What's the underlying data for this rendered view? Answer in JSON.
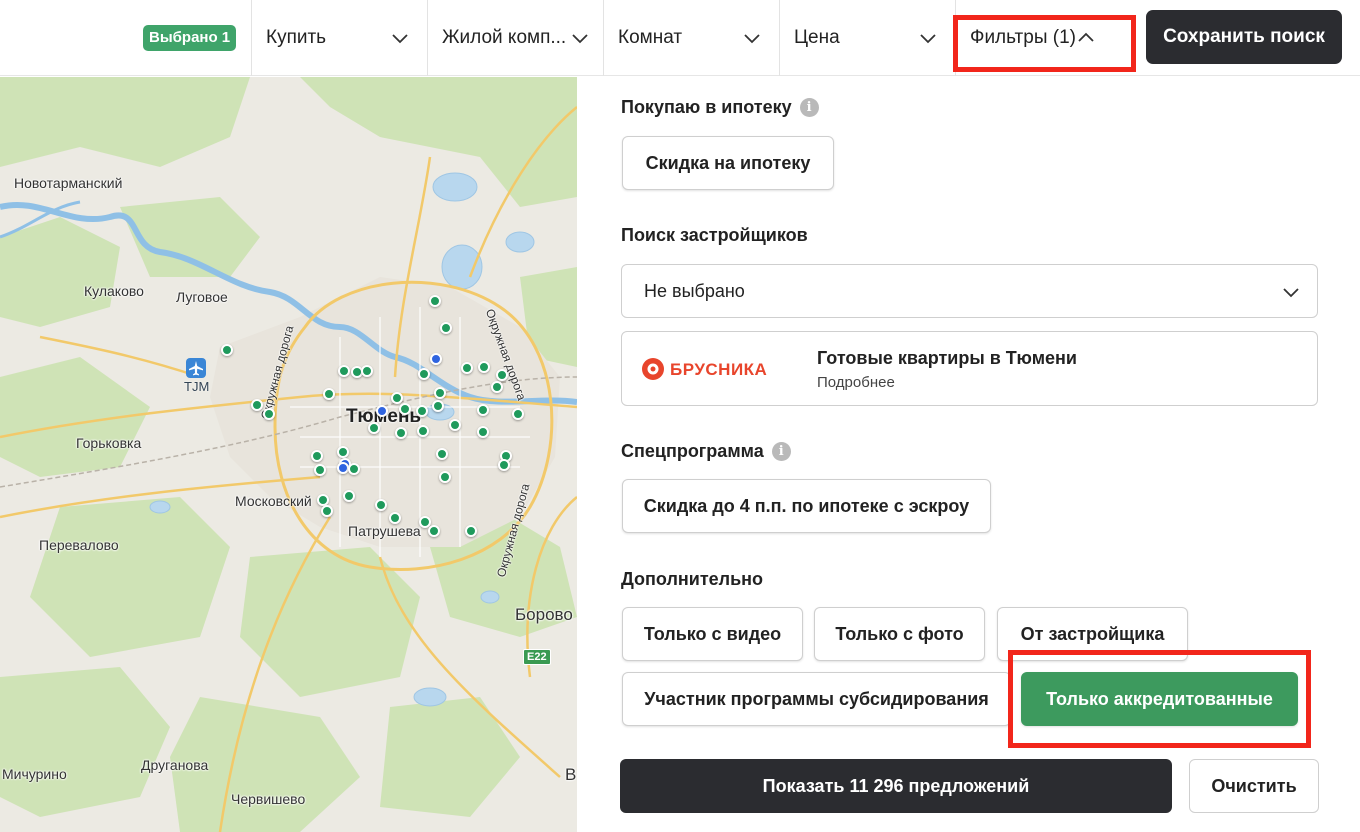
{
  "topbar": {
    "selected_badge": "Выбрано 1",
    "filters": [
      {
        "label": "Купить"
      },
      {
        "label": "Жилой комп..."
      },
      {
        "label": "Комнат"
      },
      {
        "label": "Цена"
      },
      {
        "label": "Фильтры (1)",
        "expanded": true
      }
    ],
    "save_search": "Сохранить поиск"
  },
  "map": {
    "city": "Тюмень",
    "places": [
      "Новотарманский",
      "Кулаково",
      "Луговое",
      "Горьковка",
      "Московский",
      "Перевалово",
      "Патрушева",
      "Мичурино",
      "Друганова",
      "Червишево",
      "Борово",
      "В"
    ],
    "airport_code": "TJM",
    "road_labels": [
      "Окружная дорога",
      "Окружная дорога",
      "Окружная дорога"
    ],
    "highway": "E22",
    "pin_colors": {
      "green": "#1f9a5c",
      "blue": "#2f64e0"
    }
  },
  "panel": {
    "mortgage": {
      "title": "Покупаю в ипотеку",
      "chip": "Скидка на ипотеку"
    },
    "developers": {
      "title": "Поиск застройщиков",
      "dropdown_value": "Не выбрано",
      "promo": {
        "logo": "БРУСНИКА",
        "title": "Готовые квартиры в Тюмени",
        "subtitle": "Подробнее"
      }
    },
    "special": {
      "title": "Спецпрограмма",
      "chip": "Скидка до 4 п.п. по ипотеке с эскроу"
    },
    "extra": {
      "title": "Дополнительно",
      "chips": [
        {
          "label": "Только с видео",
          "active": false
        },
        {
          "label": "Только с фото",
          "active": false
        },
        {
          "label": "От застройщика",
          "active": false
        },
        {
          "label": "Участник программы субсидирования",
          "active": false
        },
        {
          "label": "Только аккредитованные",
          "active": true
        }
      ]
    },
    "show_button": "Показать 11 296 предложений",
    "clear_button": "Очистить"
  },
  "colors": {
    "accent_green": "#3d9a5e",
    "dark_button": "#2b2c30",
    "highlight_red": "#f2261b"
  }
}
